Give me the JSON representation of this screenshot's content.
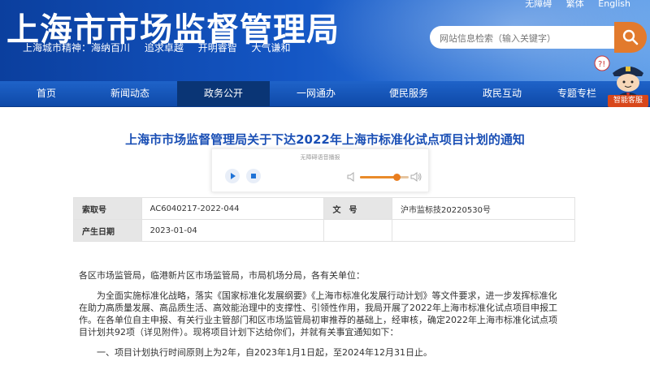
{
  "header": {
    "site_title": "上海市市场监督管理局",
    "spirit": [
      "上海城市精神：海纳百川",
      "追求卓越",
      "开明睿智",
      "大气谦和"
    ],
    "top_links": [
      "无障碍",
      "繁体",
      "English"
    ]
  },
  "search": {
    "placeholder": "网站信息检索（输入关键字）"
  },
  "nav": {
    "items": [
      "首页",
      "新闻动态",
      "政务公开",
      "一网通办",
      "便民服务",
      "政民互动",
      "专题专栏"
    ],
    "active": "政务公开"
  },
  "assistant": {
    "label": "智能客服"
  },
  "document": {
    "title": "上海市市场监督管理局关于下达2022年上海市标准化试点项目计划的通知",
    "player_caption": "无障碍语音播报",
    "volume_level": 0.75,
    "meta": {
      "index_label": "索取号",
      "index_value": "AC6040217-2022-044",
      "docno_label": "文　号",
      "docno_value": "沪市监标技20220530号",
      "date_label": "产生日期",
      "date_value": "2023-01-04"
    },
    "salutation": "各区市场监管局，临港新片区市场监管局，市局机场分局，各有关单位：",
    "paragraph": "为全面实施标准化战略，落实《国家标准化发展纲要》《上海市标准化发展行动计划》等文件要求，进一步发挥标准化在助力高质量发展、高品质生活、高效能治理中的支撑性、引领性作用，我局开展了2022年上海市标准化试点项目申报工作。在各单位自主申报、有关行业主管部门和区市场监管局初审推荐的基础上，经审核，确定2022年上海市标准化试点项目计划共92项（详见附件）。现将项目计划下达给你们，并就有关事宜通知如下：",
    "item1": "一、项目计划执行时间原则上为2年，自2023年1月1日起，至2024年12月31日止。"
  },
  "colors": {
    "header_blue": "#0b3f9e",
    "title_blue": "#1a4fb5",
    "accent_orange": "#e27a2d"
  }
}
